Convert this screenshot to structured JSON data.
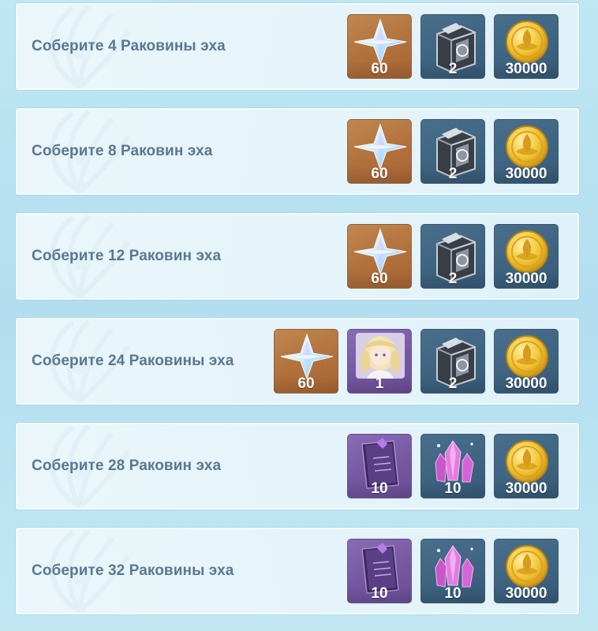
{
  "colors": {
    "label_text": "#5a7892",
    "orange_tile": "#b1703c",
    "blue_tile": "#3e6482",
    "purple_tile": "#7557a2"
  },
  "rows": [
    {
      "label": "Соберите 4 Раковины эха",
      "rewards": [
        {
          "icon": "primogem-icon",
          "quantity": "60",
          "rarity_color": "orange"
        },
        {
          "icon": "talent-book-icon",
          "quantity": "2",
          "rarity_color": "blue"
        },
        {
          "icon": "mora-coin-icon",
          "quantity": "30000",
          "rarity_color": "blue"
        }
      ]
    },
    {
      "label": "Соберите 8 Раковин эха",
      "rewards": [
        {
          "icon": "primogem-icon",
          "quantity": "60",
          "rarity_color": "orange"
        },
        {
          "icon": "talent-book-icon",
          "quantity": "2",
          "rarity_color": "blue"
        },
        {
          "icon": "mora-coin-icon",
          "quantity": "30000",
          "rarity_color": "blue"
        }
      ]
    },
    {
      "label": "Соберите 12 Раковин эха",
      "rewards": [
        {
          "icon": "primogem-icon",
          "quantity": "60",
          "rarity_color": "orange"
        },
        {
          "icon": "talent-book-icon",
          "quantity": "2",
          "rarity_color": "blue"
        },
        {
          "icon": "mora-coin-icon",
          "quantity": "30000",
          "rarity_color": "blue"
        }
      ]
    },
    {
      "label": "Соберите 24 Раковины эха",
      "rewards": [
        {
          "icon": "primogem-icon",
          "quantity": "60",
          "rarity_color": "orange"
        },
        {
          "icon": "character-portrait-icon",
          "quantity": "1",
          "rarity_color": "purple"
        },
        {
          "icon": "talent-book-icon",
          "quantity": "2",
          "rarity_color": "blue"
        },
        {
          "icon": "mora-coin-icon",
          "quantity": "30000",
          "rarity_color": "blue"
        }
      ]
    },
    {
      "label": "Соберите 28 Раковин эха",
      "rewards": [
        {
          "icon": "hero-wit-book-icon",
          "quantity": "10",
          "rarity_color": "purple"
        },
        {
          "icon": "mystic-crystal-icon",
          "quantity": "10",
          "rarity_color": "blue"
        },
        {
          "icon": "mora-coin-icon",
          "quantity": "30000",
          "rarity_color": "blue"
        }
      ]
    },
    {
      "label": "Соберите 32 Раковины эха",
      "rewards": [
        {
          "icon": "hero-wit-book-icon",
          "quantity": "10",
          "rarity_color": "purple"
        },
        {
          "icon": "mystic-crystal-icon",
          "quantity": "10",
          "rarity_color": "blue"
        },
        {
          "icon": "mora-coin-icon",
          "quantity": "30000",
          "rarity_color": "blue"
        }
      ]
    }
  ]
}
